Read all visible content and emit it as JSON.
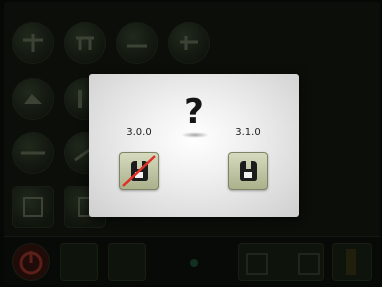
{
  "dialog": {
    "title_symbol": "?",
    "old_version": "3.0.0",
    "new_version": "3.1.0"
  },
  "background": {
    "bottom_bar_items": [
      "power-icon",
      "tool-icon",
      "machine-icon",
      "status-dot",
      "nav-controls",
      "level-bar"
    ]
  },
  "colors": {
    "dialog_bg": "#ffffff",
    "strike": "#e0302a",
    "button_face": "#c9cfac"
  }
}
